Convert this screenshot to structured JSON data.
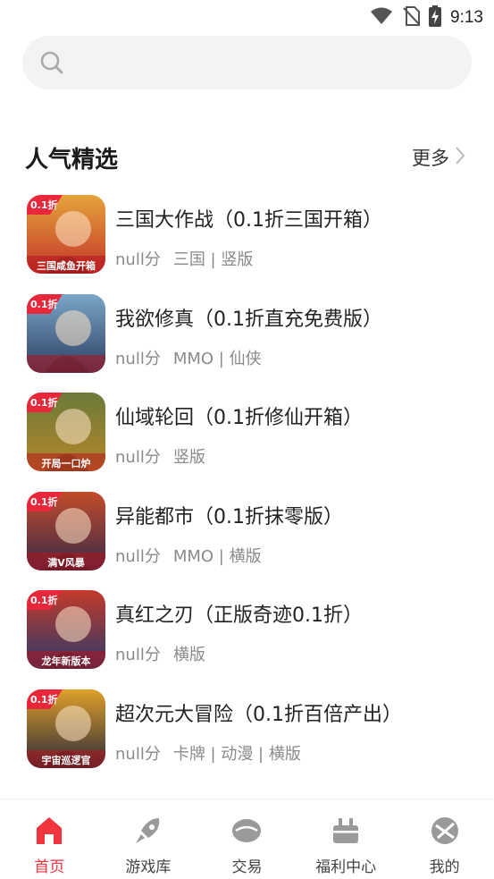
{
  "status_bar": {
    "time": "9:13",
    "icons": [
      "wifi-icon",
      "no-sim-icon",
      "battery-charging-icon"
    ]
  },
  "search": {
    "placeholder": ""
  },
  "section": {
    "title": "人气精选",
    "more_label": "更多"
  },
  "games": [
    {
      "name": "三国大作战（0.1折三国开箱）",
      "score": "null分",
      "tags": "三国 | 竖版",
      "badge": "0.1折",
      "banner": "三国咸鱼开箱",
      "colors": [
        "#e6a43a",
        "#c2352a"
      ]
    },
    {
      "name": "我欲修真（0.1折直充免费版）",
      "score": "null分",
      "tags": "MMO | 仙侠",
      "badge": "0.1折",
      "banner": "",
      "colors": [
        "#7aa6c8",
        "#2d3f63"
      ]
    },
    {
      "name": "仙域轮回（0.1折修仙开箱）",
      "score": "null分",
      "tags": "竖版",
      "badge": "0.1折",
      "banner": "开局一口炉",
      "colors": [
        "#6a7a3a",
        "#b8862a"
      ]
    },
    {
      "name": "异能都市（0.1折抹零版）",
      "score": "null分",
      "tags": "MMO | 横版",
      "badge": "0.1折",
      "banner": "满V风暴",
      "colors": [
        "#c24b2a",
        "#3a2a4a"
      ]
    },
    {
      "name": "真红之刃（正版奇迹0.1折）",
      "score": "null分",
      "tags": "横版",
      "badge": "0.1折",
      "banner": "龙年新版本",
      "colors": [
        "#c23a2a",
        "#2a3a6a"
      ]
    },
    {
      "name": "超次元大冒险（0.1折百倍产出）",
      "score": "null分",
      "tags": "卡牌 | 动漫 | 横版",
      "badge": "0.1折",
      "banner": "宇宙巡逻官",
      "colors": [
        "#e0a02a",
        "#2a2a3a"
      ]
    }
  ],
  "bottom_nav": [
    {
      "label": "首页",
      "icon": "home-icon",
      "active": true
    },
    {
      "label": "游戏库",
      "icon": "rocket-icon",
      "active": false
    },
    {
      "label": "交易",
      "icon": "trade-icon",
      "active": false
    },
    {
      "label": "福利中心",
      "icon": "gift-icon",
      "active": false
    },
    {
      "label": "我的",
      "icon": "profile-icon",
      "active": false
    }
  ],
  "colors": {
    "accent": "#f1353f",
    "inactive_icon": "#9a9a9a",
    "search_bg": "#f3f3f3"
  }
}
